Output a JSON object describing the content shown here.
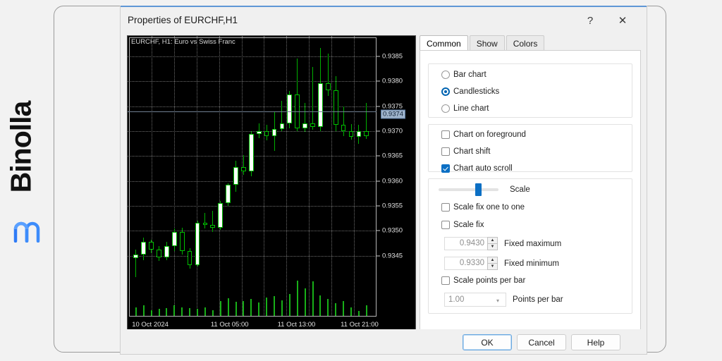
{
  "brand": {
    "name": "Binolla",
    "logo_icon": "binolla-m-logo",
    "logo_color": "#2f7bf6"
  },
  "dialog": {
    "title": "Properties of EURCHF,H1",
    "help_icon": "question-mark-icon",
    "close_icon": "close-x-icon"
  },
  "tabs": [
    {
      "label": "Common",
      "active": true
    },
    {
      "label": "Show",
      "active": false
    },
    {
      "label": "Colors",
      "active": false
    }
  ],
  "chart_type": {
    "options": [
      {
        "label": "Bar chart",
        "selected": false
      },
      {
        "label": "Candlesticks",
        "selected": true
      },
      {
        "label": "Line chart",
        "selected": false
      }
    ]
  },
  "chart_options": [
    {
      "label": "Chart on foreground",
      "checked": false
    },
    {
      "label": "Chart shift",
      "checked": false
    },
    {
      "label": "Chart auto scroll",
      "checked": true
    }
  ],
  "scale": {
    "slider_label": "Scale",
    "slider_value": 66,
    "fix_one_to_one": {
      "label": "Scale fix one to one",
      "checked": false
    },
    "scale_fix": {
      "label": "Scale fix",
      "checked": false
    },
    "fixed_maximum": {
      "label": "Fixed maximum",
      "value": "0.9430"
    },
    "fixed_minimum": {
      "label": "Fixed minimum",
      "value": "0.9330"
    },
    "points_per_bar_check": {
      "label": "Scale points per bar",
      "checked": false
    },
    "points_per_bar": {
      "label": "Points per bar",
      "value": "1.00"
    }
  },
  "footer": {
    "ok": "OK",
    "cancel": "Cancel",
    "help": "Help"
  },
  "chart_data": {
    "type": "candlestick",
    "title": "EURCHF, H1:  Euro vs Swiss Franc",
    "symbol": "EURCHF",
    "timeframe": "H1",
    "description": "Euro vs Swiss Franc",
    "background": "#000000",
    "up_color": "#ffffff",
    "down_color": "#000000",
    "outline_color": "#00c000",
    "grid": true,
    "grid_color": "#6d6d6d",
    "ylabel": "",
    "xlabel": "",
    "ylim": [
      0.93415,
      0.93885
    ],
    "y_ticks": [
      "0.9385",
      "0.9380",
      "0.9375",
      "0.9370",
      "0.9365",
      "0.9360",
      "0.9355",
      "0.9350",
      "0.9345"
    ],
    "y_tick_values": [
      0.9385,
      0.938,
      0.9375,
      0.937,
      0.9365,
      0.936,
      0.9355,
      0.935,
      0.9345
    ],
    "current_price": "0.9374",
    "current_price_value": 0.9374,
    "x_ticks": [
      "10 Oct 2024",
      "11 Oct 05:00",
      "11 Oct 13:00",
      "11 Oct 21:00"
    ],
    "x_tick_positions": [
      0.012,
      0.33,
      0.6,
      0.855
    ],
    "candles": [
      {
        "o": 0.93446,
        "h": 0.93463,
        "l": 0.93408,
        "c": 0.93452,
        "v": 0.22
      },
      {
        "o": 0.93452,
        "h": 0.93487,
        "l": 0.93442,
        "c": 0.93478,
        "v": 0.27
      },
      {
        "o": 0.93478,
        "h": 0.93482,
        "l": 0.93455,
        "c": 0.93462,
        "v": 0.14
      },
      {
        "o": 0.93462,
        "h": 0.9347,
        "l": 0.9344,
        "c": 0.93447,
        "v": 0.17
      },
      {
        "o": 0.93447,
        "h": 0.93478,
        "l": 0.93442,
        "c": 0.9347,
        "v": 0.2
      },
      {
        "o": 0.9347,
        "h": 0.93505,
        "l": 0.9346,
        "c": 0.93498,
        "v": 0.26
      },
      {
        "o": 0.93498,
        "h": 0.93506,
        "l": 0.93452,
        "c": 0.9346,
        "v": 0.22
      },
      {
        "o": 0.9346,
        "h": 0.93465,
        "l": 0.93424,
        "c": 0.93432,
        "v": 0.2
      },
      {
        "o": 0.93432,
        "h": 0.9352,
        "l": 0.93428,
        "c": 0.93516,
        "v": 0.18
      },
      {
        "o": 0.93516,
        "h": 0.93536,
        "l": 0.93505,
        "c": 0.93512,
        "v": 0.22
      },
      {
        "o": 0.93512,
        "h": 0.9354,
        "l": 0.93498,
        "c": 0.93506,
        "v": 0.15
      },
      {
        "o": 0.93506,
        "h": 0.9356,
        "l": 0.93502,
        "c": 0.93556,
        "v": 0.38
      },
      {
        "o": 0.93556,
        "h": 0.93595,
        "l": 0.9355,
        "c": 0.93592,
        "v": 0.45
      },
      {
        "o": 0.93592,
        "h": 0.9364,
        "l": 0.93578,
        "c": 0.93628,
        "v": 0.35
      },
      {
        "o": 0.93628,
        "h": 0.93652,
        "l": 0.93612,
        "c": 0.9362,
        "v": 0.37
      },
      {
        "o": 0.9362,
        "h": 0.937,
        "l": 0.9361,
        "c": 0.93694,
        "v": 0.42
      },
      {
        "o": 0.93694,
        "h": 0.93716,
        "l": 0.93686,
        "c": 0.937,
        "v": 0.34
      },
      {
        "o": 0.937,
        "h": 0.93712,
        "l": 0.93682,
        "c": 0.9369,
        "v": 0.46
      },
      {
        "o": 0.9369,
        "h": 0.93738,
        "l": 0.9366,
        "c": 0.93704,
        "v": 0.5
      },
      {
        "o": 0.93704,
        "h": 0.9376,
        "l": 0.937,
        "c": 0.93716,
        "v": 0.4
      },
      {
        "o": 0.93716,
        "h": 0.9378,
        "l": 0.93706,
        "c": 0.93774,
        "v": 0.55
      },
      {
        "o": 0.93774,
        "h": 0.93846,
        "l": 0.937,
        "c": 0.93706,
        "v": 0.9
      },
      {
        "o": 0.93706,
        "h": 0.93756,
        "l": 0.93698,
        "c": 0.93716,
        "v": 0.7
      },
      {
        "o": 0.93716,
        "h": 0.93828,
        "l": 0.93702,
        "c": 0.93708,
        "v": 0.88
      },
      {
        "o": 0.93708,
        "h": 0.93866,
        "l": 0.937,
        "c": 0.93796,
        "v": 0.52
      },
      {
        "o": 0.93796,
        "h": 0.93856,
        "l": 0.9377,
        "c": 0.93782,
        "v": 0.42
      },
      {
        "o": 0.93782,
        "h": 0.9381,
        "l": 0.937,
        "c": 0.93712,
        "v": 0.32
      },
      {
        "o": 0.93712,
        "h": 0.9375,
        "l": 0.9369,
        "c": 0.937,
        "v": 0.38
      },
      {
        "o": 0.937,
        "h": 0.93714,
        "l": 0.93683,
        "c": 0.93688,
        "v": 0.22
      },
      {
        "o": 0.93688,
        "h": 0.93712,
        "l": 0.93674,
        "c": 0.937,
        "v": 0.12
      },
      {
        "o": 0.937,
        "h": 0.93756,
        "l": 0.93684,
        "c": 0.9369,
        "v": 0.26
      }
    ]
  }
}
